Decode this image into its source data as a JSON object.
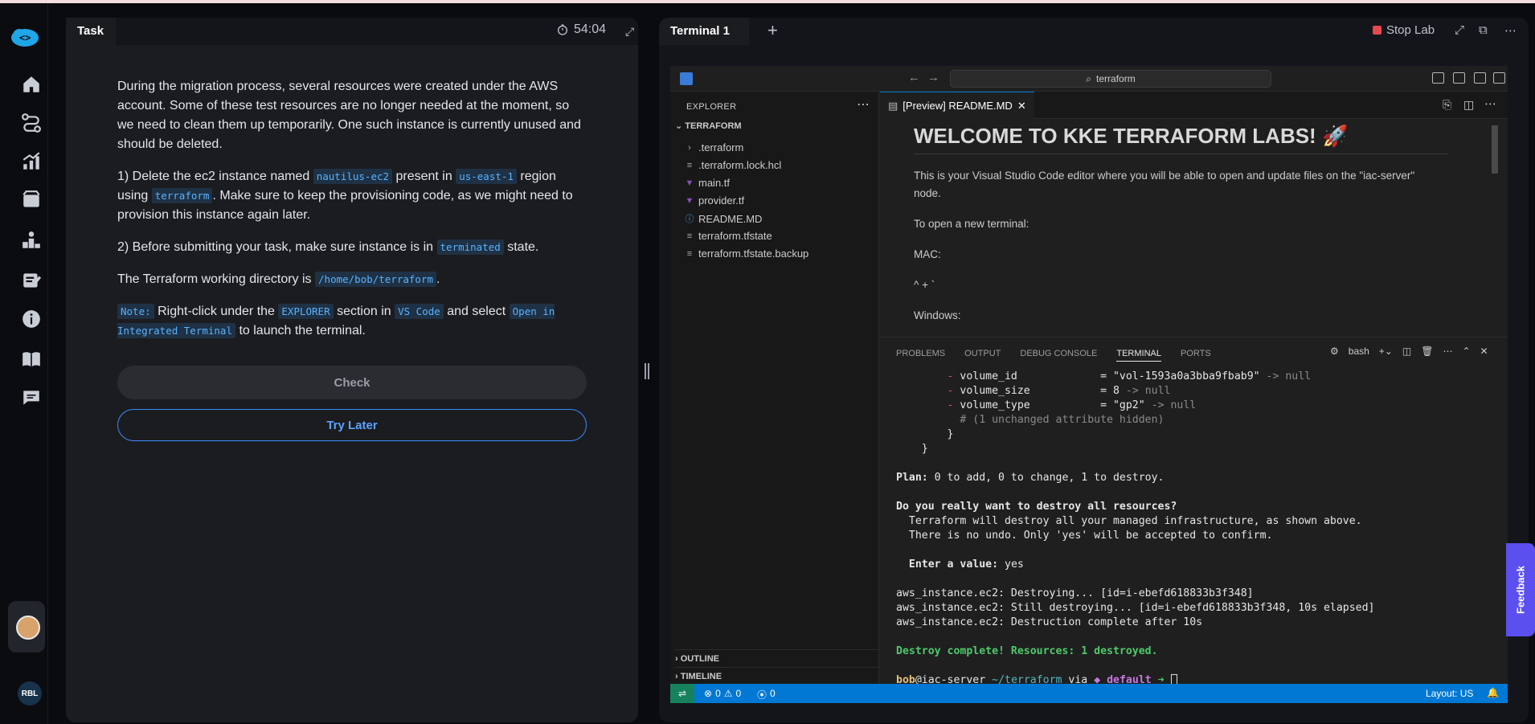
{
  "task_panel": {
    "tab_label": "Task",
    "timer": "54:04",
    "paragraph_1": "During the migration process, several resources were created under the AWS account. Some of these test resources are no longer needed at the moment, so we need to clean them up temporarily. One such instance is currently unused and should be deleted.",
    "step_1": {
      "prefix": "1) Delete the ec2 instance named",
      "code_1": "nautilus-ec2",
      "mid_1": "present in",
      "code_2": "us-east-1",
      "mid_2": "region using",
      "code_3": "terraform",
      "suffix": ". Make sure to keep the provisioning code, as we might need to provision this instance again later."
    },
    "step_2": {
      "prefix": "2) Before submitting your task, make sure instance is in",
      "code": "terminated",
      "suffix": "state."
    },
    "workdir": {
      "prefix": "The Terraform working directory is",
      "code": "/home/bob/terraform",
      "suffix": "."
    },
    "note": {
      "code_note": "Note:",
      "text_1": "Right-click under the",
      "code_explorer": "EXPLORER",
      "text_2": "section in",
      "code_vscode": "VS Code",
      "text_3": "and select",
      "code_open": "Open in Integrated Terminal",
      "text_4": "to launch the terminal."
    },
    "check_button": "Check",
    "try_later_button": "Try Later"
  },
  "terminal_panel": {
    "tab_label": "Terminal 1",
    "add_tab": "+",
    "stop_lab": "Stop Lab"
  },
  "vscode": {
    "search": "terraform",
    "explorer_title": "EXPLORER",
    "root_folder": "TERRAFORM",
    "files": [
      {
        "name": ".terraform",
        "icon": "chevron-right-icon"
      },
      {
        "name": ".terraform.lock.hcl",
        "icon": "file-lines-icon"
      },
      {
        "name": "main.tf",
        "icon": "terraform-icon"
      },
      {
        "name": "provider.tf",
        "icon": "terraform-icon"
      },
      {
        "name": "README.MD",
        "icon": "info-icon"
      },
      {
        "name": "terraform.tfstate",
        "icon": "file-lines-icon"
      },
      {
        "name": "terraform.tfstate.backup",
        "icon": "file-lines-icon"
      }
    ],
    "outline": "OUTLINE",
    "timeline": "TIMELINE",
    "editor_tab": "[Preview] README.MD",
    "readme": {
      "heading": "WELCOME TO KKE TERRAFORM LABS! 🚀",
      "p1": "This is your Visual Studio Code editor where you will be able to open and update files on the \"iac-server\" node.",
      "p2": "To open a new terminal:",
      "p3": "MAC:",
      "p4": "^ + `",
      "p5": "Windows:"
    },
    "panel_tabs": [
      "PROBLEMS",
      "OUTPUT",
      "DEBUG CONSOLE",
      "TERMINAL",
      "PORTS"
    ],
    "active_panel_tab": "TERMINAL",
    "shell": "bash",
    "terminal_lines": {
      "l1_key": "volume_id",
      "l1_val": "\"vol-1593a0a3bba9fbab9\"",
      "l1_null": "-> null",
      "l2_key": "volume_size",
      "l2_val": "8",
      "l2_null": "-> null",
      "l3_key": "volume_type",
      "l3_val": "\"gp2\"",
      "l3_null": "-> null",
      "l4": "# (1 unchanged attribute hidden)",
      "plan_label": "Plan:",
      "plan_text": "0 to add, 0 to change, 1 to destroy.",
      "q": "Do you really want to destroy all resources?",
      "q1": "Terraform will destroy all your managed infrastructure, as shown above.",
      "q2": "There is no undo. Only 'yes' will be accepted to confirm.",
      "enter_label": "Enter a value:",
      "enter_val": "yes",
      "d1": "aws_instance.ec2: Destroying... [id=i-ebefd618833b3f348]",
      "d2": "aws_instance.ec2: Still destroying... [id=i-ebefd618833b3f348, 10s elapsed]",
      "d3": "aws_instance.ec2: Destruction complete after 10s",
      "done": "Destroy complete! Resources: 1 destroyed.",
      "prompt_user": "bob",
      "prompt_host": "@iac-server",
      "prompt_dir": "~/terraform",
      "prompt_via": "via",
      "prompt_ws": "default"
    },
    "status": {
      "errors": "0",
      "warnings": "0",
      "ports": "0",
      "layout": "Layout: US"
    }
  },
  "sidebar": {
    "user_initials": "RBL"
  },
  "feedback": "Feedback"
}
